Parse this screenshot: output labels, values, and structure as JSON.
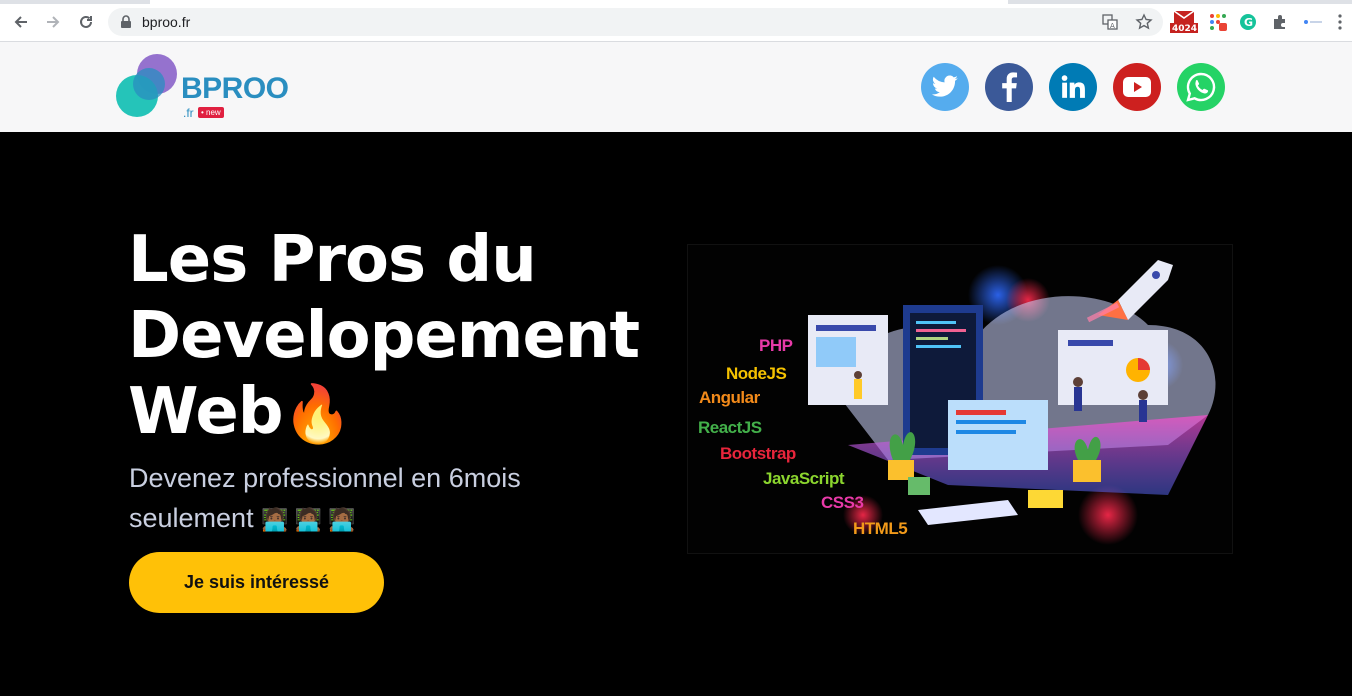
{
  "browser": {
    "url": "bproo.fr",
    "gmail_badge": "40241"
  },
  "header": {
    "logo_text": "BPROO",
    "logo_sub": ".fr",
    "logo_badge": "new",
    "social": [
      {
        "name": "twitter",
        "color": "#55acee"
      },
      {
        "name": "facebook",
        "color": "#3b5998"
      },
      {
        "name": "linkedin",
        "color": "#007bb5"
      },
      {
        "name": "youtube",
        "color": "#cd201f"
      },
      {
        "name": "whatsapp",
        "color": "#25d366"
      }
    ]
  },
  "hero": {
    "title_line1": "Les Pros du",
    "title_line2": "Developement",
    "title_line3": "Web",
    "title_emoji": "🔥",
    "subtitle_line1": "Devenez professionnel en 6mois",
    "subtitle_line2": "seulement",
    "subtitle_emojis": "🧑🏾‍💻 🧑🏾‍💻 🧑🏾‍💻",
    "cta_label": "Je suis intéressé"
  },
  "illustration": {
    "technologies": [
      {
        "label": "PHP",
        "color": "#e83aa8"
      },
      {
        "label": "NodeJS",
        "color": "#f5c200"
      },
      {
        "label": "Angular",
        "color": "#f28a1a"
      },
      {
        "label": "ReactJS",
        "color": "#43b04a"
      },
      {
        "label": "Bootstrap",
        "color": "#e8253b"
      },
      {
        "label": "JavaScript",
        "color": "#8bd52e"
      },
      {
        "label": "CSS3",
        "color": "#e83aa8"
      },
      {
        "label": "HTML5",
        "color": "#f29a1a"
      }
    ]
  },
  "colors": {
    "cta": "#ffc107",
    "hero_bg": "#000000",
    "header_bg": "#f7f7f8"
  }
}
